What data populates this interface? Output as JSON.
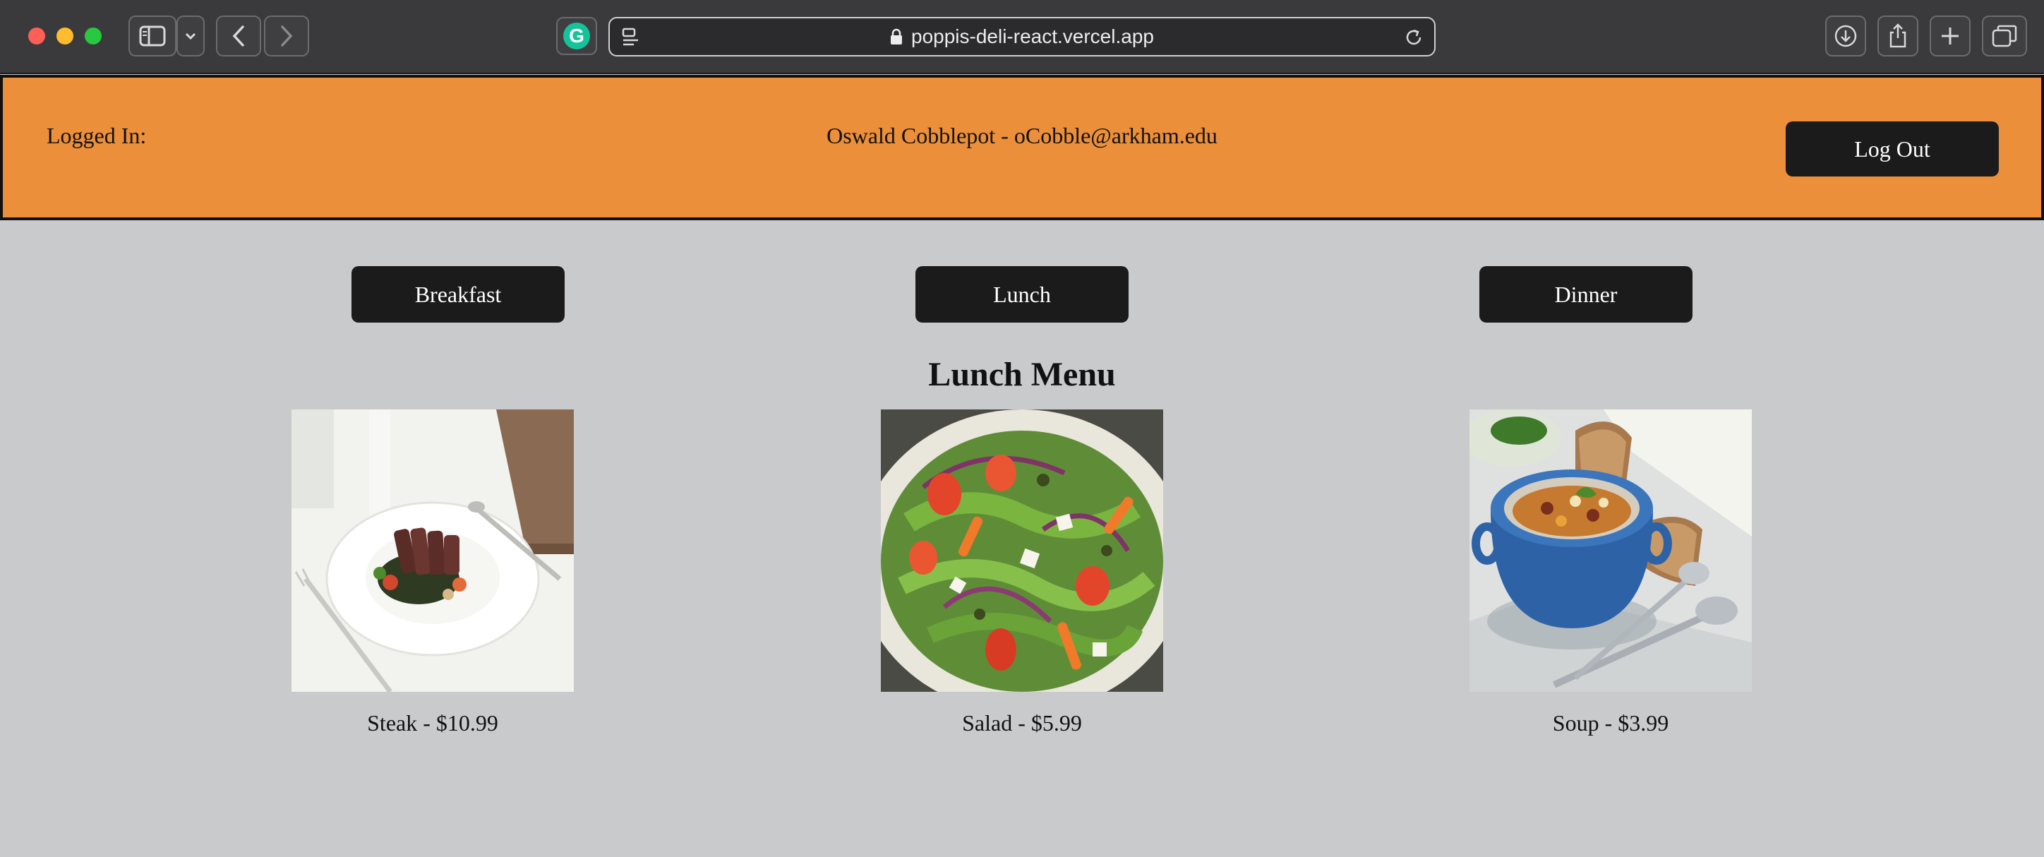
{
  "browser": {
    "url": "poppis-deli-react.vercel.app",
    "grammarly_letter": "G",
    "icons": [
      "sidebar-icon",
      "chevron-down-icon",
      "back-icon",
      "forward-icon",
      "reader-icon",
      "lock-icon",
      "reload-icon",
      "download-icon",
      "share-icon",
      "new-tab-icon",
      "tab-overview-icon"
    ]
  },
  "header": {
    "logged_in_label": "Logged In:",
    "user": "Oswald Cobblepot - oCobble@arkham.edu",
    "logout_label": "Log Out"
  },
  "meals": {
    "breakfast": "Breakfast",
    "lunch": "Lunch",
    "dinner": "Dinner"
  },
  "menu": {
    "title": "Lunch Menu",
    "items": [
      {
        "label": "Steak - $10.99"
      },
      {
        "label": "Salad - $5.99"
      },
      {
        "label": "Soup - $3.99"
      }
    ]
  },
  "colors": {
    "header_bg": "#ec8f3a",
    "page_bg": "#c9cacc",
    "button_bg": "#1b1b1b",
    "button_text": "#ffffff"
  }
}
